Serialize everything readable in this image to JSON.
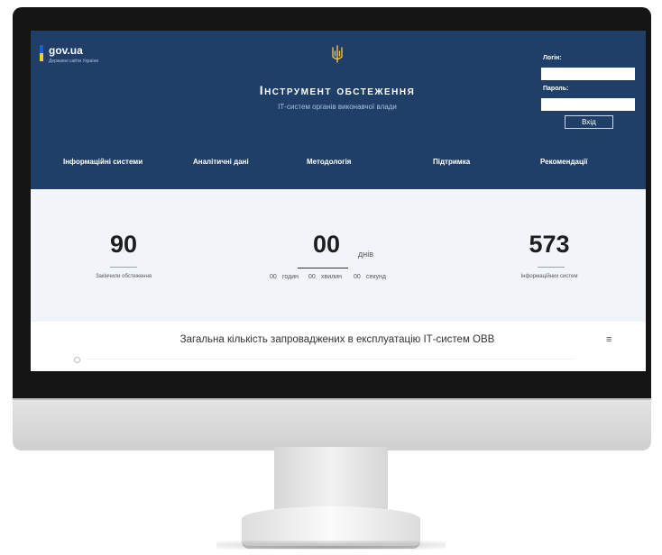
{
  "logo": {
    "name": "gov.ua",
    "subtitle": "Державні сайти України"
  },
  "site": {
    "title": "Інструмент обстеження",
    "subtitle": "ІТ-систем органів виконавчої влади"
  },
  "login": {
    "login_label": "Логін:",
    "login_value": "",
    "password_label": "Пароль:",
    "password_value": "",
    "submit_label": "Вхід"
  },
  "nav": [
    {
      "label": "Інформаційні системи"
    },
    {
      "label": "Аналітичні дані"
    },
    {
      "label": "Методологія"
    },
    {
      "label": "Підтримка"
    },
    {
      "label": "Рекомендації"
    }
  ],
  "stats": {
    "completed": {
      "value": "90",
      "label": "Закінчили обстеження"
    },
    "countdown": {
      "days": "00",
      "days_label": "днів",
      "hours": "00",
      "hours_label": "годин",
      "minutes": "00",
      "minutes_label": "хвилин",
      "seconds": "00",
      "seconds_label": "секунд"
    },
    "systems": {
      "value": "573",
      "label": "Інформаційних систем"
    }
  },
  "panel": {
    "title": "Загальна кількість запроваджених в експлуатацію ІТ-систем ОВВ",
    "menu_icon": "≡"
  },
  "colors": {
    "header_bg": "#1f3f68",
    "page_bg": "#f1f5f9",
    "flag_blue": "#1b60c7",
    "flag_yellow": "#f4cc2f",
    "trident_gold": "#e8c14a"
  }
}
